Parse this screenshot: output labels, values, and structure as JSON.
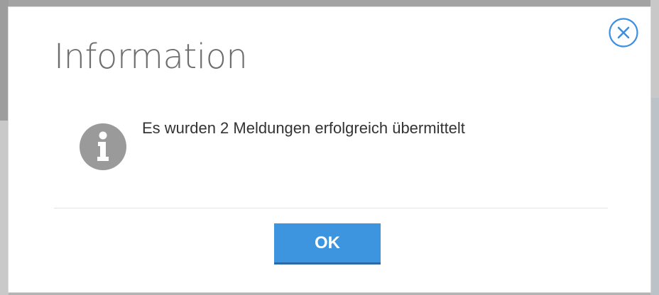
{
  "dialog": {
    "title": "Information",
    "message": "Es wurden 2 Meldungen erfolgreich übermittelt",
    "ok_label": "OK",
    "icons": {
      "close": "close-circle-icon",
      "info": "info-circle-icon"
    }
  },
  "colors": {
    "accent": "#3d95e0",
    "close_icon": "#3d8fe0",
    "info_icon": "#9a9a9a",
    "title_text": "#6e6e6e",
    "message_text": "#333333"
  }
}
